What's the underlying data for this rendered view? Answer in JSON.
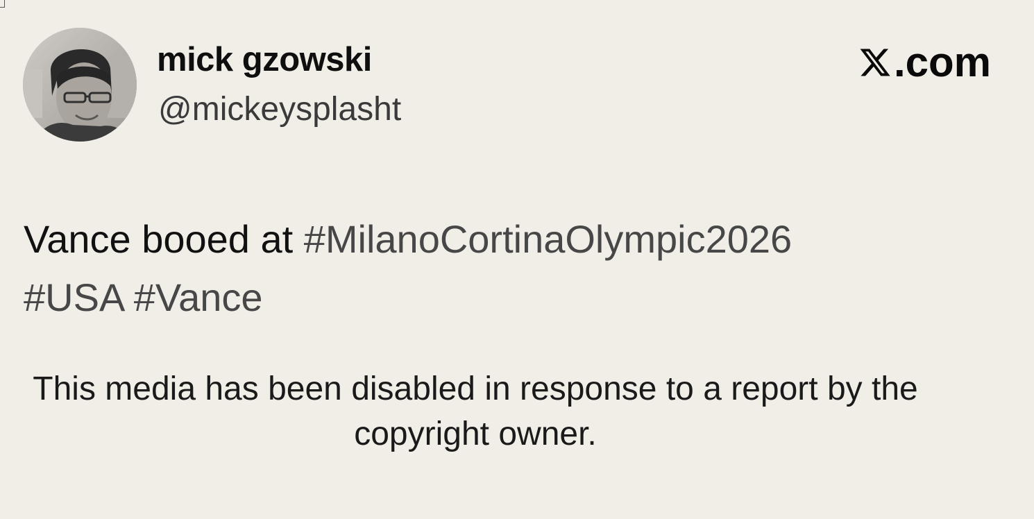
{
  "tweet": {
    "author": {
      "display_name": "mick gzowski",
      "handle": "@mickeysplasht",
      "avatar": "profile-photo"
    },
    "brand": {
      "icon": "x-logo-icon",
      "label": ".com"
    },
    "text": {
      "plain": "Vance booed at",
      "hashtags": [
        "#MilanoCortinaOlympic2026",
        "#USA",
        "#Vance"
      ]
    },
    "media_notice": "This media has been disabled in response to a report by the copyright owner."
  },
  "colors": {
    "background": "#f1ede7",
    "text": "#111111",
    "hashtag": "#474747",
    "handle": "#3a3a3a"
  }
}
